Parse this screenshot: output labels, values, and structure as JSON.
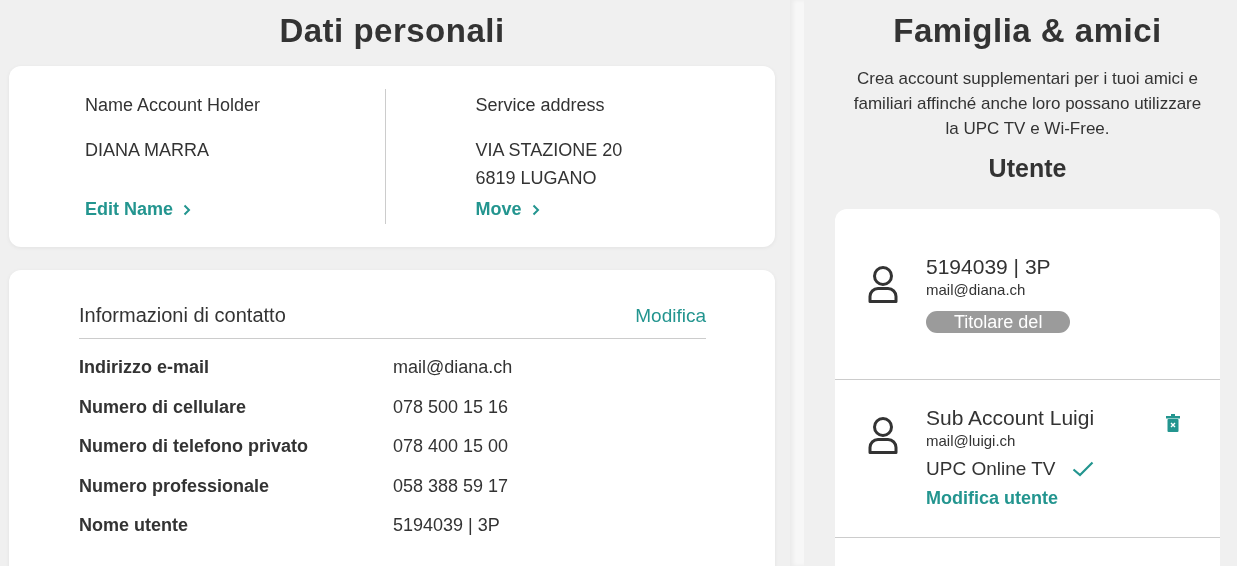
{
  "personal": {
    "title": "Dati personali",
    "holder": {
      "label": "Name Account Holder",
      "lines": [
        "DIANA MARRA"
      ],
      "link": "Edit Name"
    },
    "address": {
      "label": "Service address",
      "lines": [
        "VIA STAZIONE 20",
        "6819 LUGANO"
      ],
      "link": "Move"
    },
    "contact": {
      "title": "Informazioni di contatto",
      "edit": "Modifica",
      "rows": [
        {
          "label": "Indirizzo e-mail",
          "value": "mail@diana.ch"
        },
        {
          "label": "Numero di cellulare",
          "value": "078 500 15 16"
        },
        {
          "label": "Numero di telefono privato",
          "value": "078 400 15 00"
        },
        {
          "label": "Numero professionale",
          "value": "058 388 59 17"
        },
        {
          "label": "Nome utente",
          "value": "5194039 | 3P"
        }
      ]
    }
  },
  "family": {
    "title": "Famiglia & amici",
    "description": "Crea account supplementari per i tuoi amici e familiari affinché anche loro possano utilizzare la UPC TV e Wi-Free.",
    "subtitle": "Utente",
    "users": [
      {
        "name": "5194039 | 3P",
        "email": "mail@diana.ch",
        "badge": "Titolare del"
      },
      {
        "name": "Sub Account Luigi",
        "email": "mail@luigi.ch",
        "service": "UPC Online TV",
        "service_active": true,
        "link": "Modifica utente",
        "deletable": true
      }
    ]
  }
}
